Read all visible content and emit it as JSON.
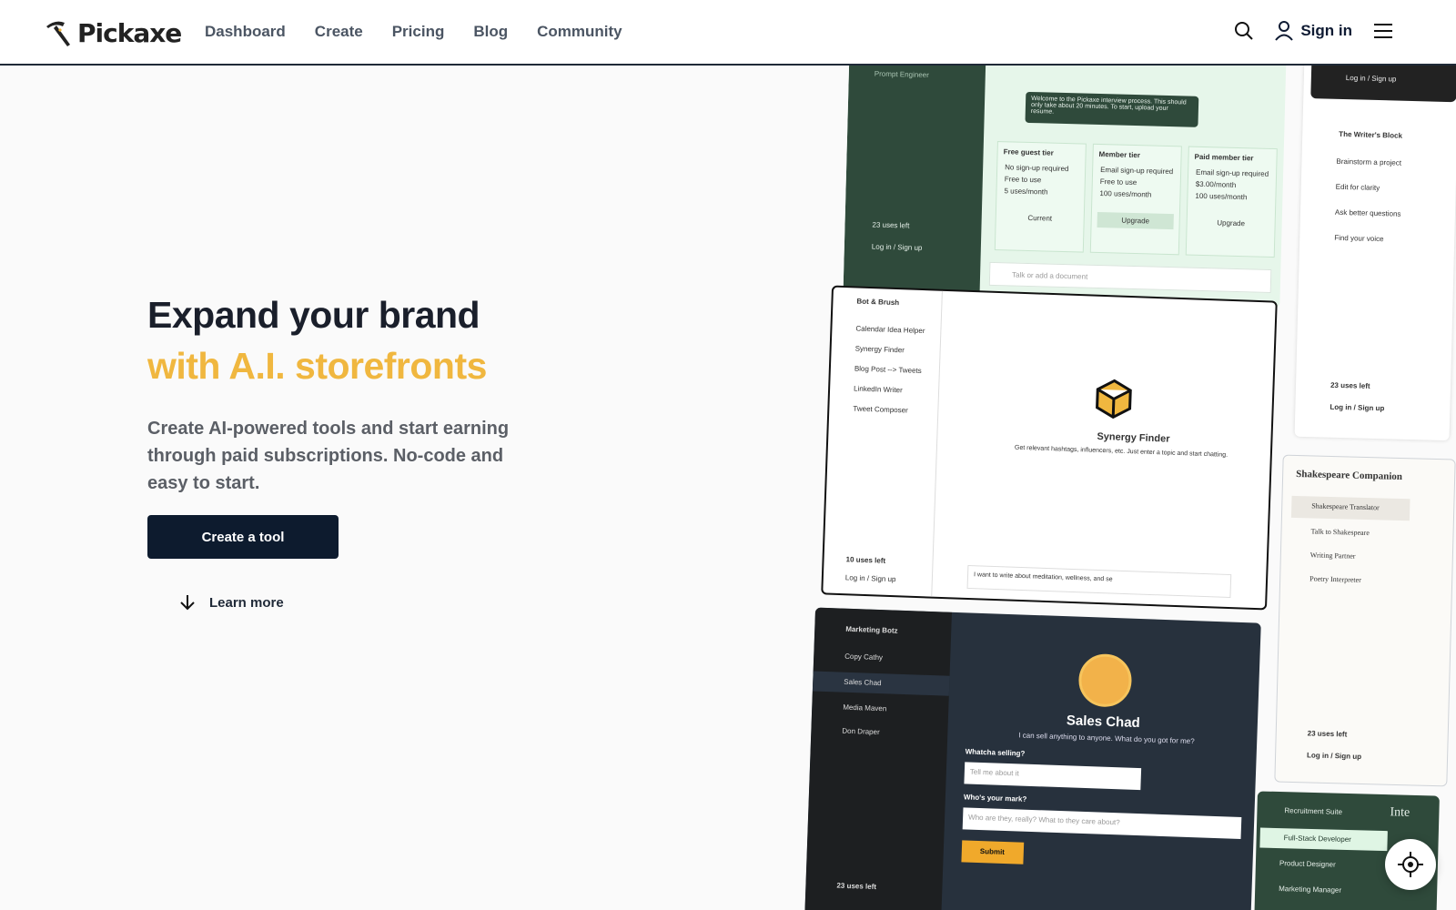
{
  "nav": {
    "brand": "Pickaxe",
    "links": [
      "Dashboard",
      "Create",
      "Pricing",
      "Blog",
      "Community"
    ],
    "signin": "Sign in"
  },
  "hero": {
    "title_line1": "Expand your brand",
    "title_line2": "with A.I. storefronts",
    "subtitle": "Create AI-powered tools and start earning through paid subscriptions. No-code and easy to start.",
    "cta": "Create a tool",
    "learn_more": "Learn more"
  },
  "colors": {
    "accent": "#f0b73f",
    "navy": "#0d1b2e",
    "green": "#2f4a3b"
  },
  "collage": {
    "interview": {
      "sidebar_title": "Prompt Engineer",
      "uses": "23 uses left",
      "login": "Log in / Sign up",
      "message": "Welcome to the Pickaxe interview process. This should only take about 20 minutes. To start, upload your resume.",
      "tiers": [
        {
          "name": "Free guest tier",
          "items": [
            "No sign-up required",
            "Free to use",
            "5 uses/month"
          ],
          "button": "Current"
        },
        {
          "name": "Member tier",
          "items": [
            "Email sign-up required",
            "Free to use",
            "100 uses/month"
          ],
          "button": "Upgrade"
        },
        {
          "name": "Paid member tier",
          "items": [
            "Email sign-up required",
            "$3.00/month",
            "100 uses/month"
          ],
          "button": "Upgrade"
        }
      ],
      "input_placeholder": "Talk or add a document"
    },
    "writers": {
      "login_top": "Log in / Sign up",
      "title": "The Writer's Block",
      "items": [
        "Brainstorm a project",
        "Edit for clarity",
        "Ask better questions",
        "Find your voice"
      ],
      "uses": "23 uses left",
      "login": "Log in / Sign up"
    },
    "synergy": {
      "sidebar_title": "Bot & Brush",
      "items": [
        "Calendar Idea Helper",
        "Synergy Finder",
        "Blog Post --> Tweets",
        "LinkedIn Writer",
        "Tweet Composer"
      ],
      "uses": "10 uses left",
      "login": "Log in / Sign up",
      "title": "Synergy Finder",
      "desc": "Get relevant hashtags, influencers, etc. Just enter a topic and start chatting.",
      "input": "I want to write about meditation, wellness, and se"
    },
    "shakespeare": {
      "title": "Shakespeare Companion",
      "items": [
        "Shakespeare Translator",
        "Talk to Shakespeare",
        "Writing Partner",
        "Poetry Interpreter"
      ],
      "uses": "23 uses left",
      "login": "Log in / Sign up"
    },
    "marketing": {
      "sidebar_title": "Marketing Botz",
      "items": [
        "Copy Cathy",
        "Sales Chad",
        "Media Maven",
        "Don Draper"
      ],
      "uses": "23 uses left",
      "title": "Sales Chad",
      "tagline": "I can sell anything to anyone. What do you got for me?",
      "q1": "Whatcha selling?",
      "p1": "Tell me about it",
      "q2": "Who's your mark?",
      "p2": "Who are they, really? What to they care about?",
      "submit": "Submit"
    },
    "recruit": {
      "sidebar_title": "Recruitment Suite",
      "items": [
        "Full-Stack Developer",
        "Product Designer",
        "Marketing Manager"
      ],
      "partial": "Inte"
    }
  }
}
